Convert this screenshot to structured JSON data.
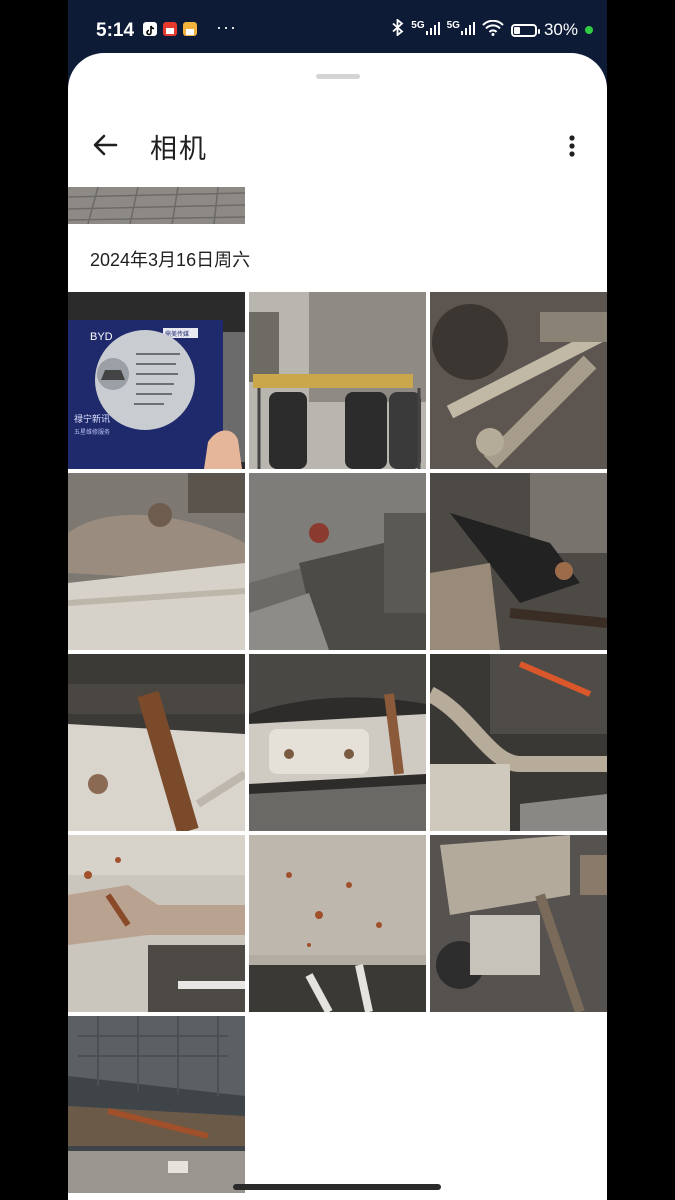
{
  "status_bar": {
    "time": "5:14",
    "more": "···",
    "network1": "5G",
    "network2": "5G",
    "battery": "30%",
    "battery_level": 0.3,
    "app_icons": [
      "tiktok-icon",
      "news-icon",
      "shop-icon"
    ]
  },
  "header": {
    "title": "相机",
    "back_icon": "arrow-left-icon",
    "menu_icon": "more-vertical-icon"
  },
  "gallery": {
    "date": "2024年3月16日周六",
    "photos": [
      {
        "id": 1,
        "subject": "BYD inspection card"
      },
      {
        "id": 2,
        "subject": "tires on lift"
      },
      {
        "id": 3,
        "subject": "suspension arm"
      },
      {
        "id": 4,
        "subject": "rusty chassis bracket"
      },
      {
        "id": 5,
        "subject": "underbody panel"
      },
      {
        "id": 6,
        "subject": "subframe mount"
      },
      {
        "id": 7,
        "subject": "rusty rail"
      },
      {
        "id": 8,
        "subject": "shield bracket"
      },
      {
        "id": 9,
        "subject": "motor and axle"
      },
      {
        "id": 10,
        "subject": "rusty crossmember"
      },
      {
        "id": 11,
        "subject": "spotted underbody"
      },
      {
        "id": 12,
        "subject": "rear suspension"
      },
      {
        "id": 13,
        "subject": "battery pack underside"
      }
    ]
  },
  "card": {
    "brand": "BYD",
    "partner": "鼎美传媒",
    "footer1": "禄宁新讯",
    "footer2": "五星维修服务"
  },
  "colors": {
    "status_bg": "#0d1b36",
    "sheet_bg": "#ffffff",
    "text": "#1f1f1f",
    "card_blue": "#1f2a6d"
  }
}
